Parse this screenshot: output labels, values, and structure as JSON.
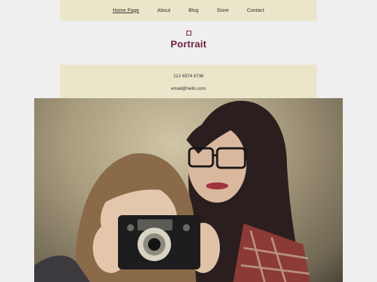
{
  "nav": {
    "items": [
      {
        "label": "Home Page",
        "active": true
      },
      {
        "label": "About"
      },
      {
        "label": "Blog"
      },
      {
        "label": "Store"
      },
      {
        "label": "Contact"
      }
    ]
  },
  "logo": {
    "text": "Portrait",
    "icon": "square-outline-icon"
  },
  "contact": {
    "phone": "212 6574 6736",
    "email": "email@hello.com"
  },
  "colors": {
    "accent": "#6b1d3a",
    "band": "#ebe6c9",
    "page_bg": "#f0eff0"
  }
}
